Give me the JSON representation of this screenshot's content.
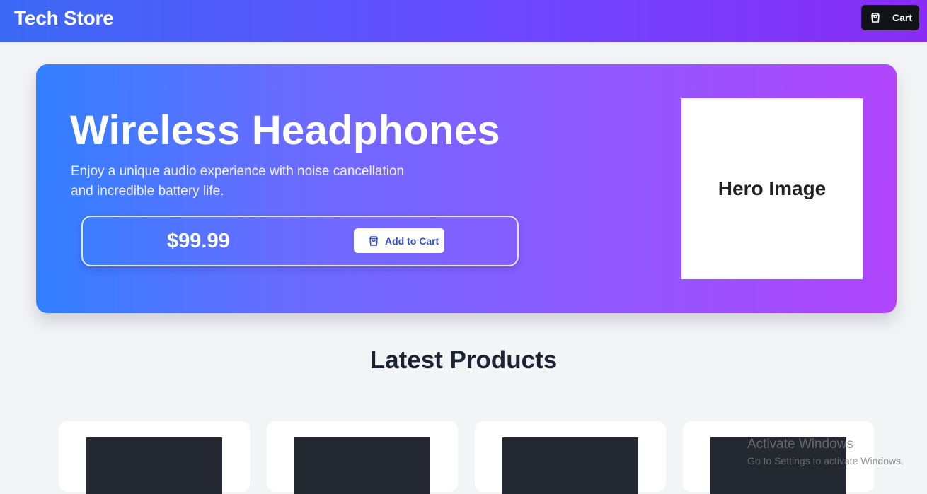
{
  "navbar": {
    "brand": "Tech Store",
    "cart_label": "Cart",
    "cart_icon": "shopping-bag-icon"
  },
  "hero": {
    "title": "Wireless Headphones",
    "description": "Enjoy a unique audio experience with noise cancellation and incredible battery life.",
    "price": "$99.99",
    "add_to_cart_label": "Add to Cart",
    "add_to_cart_icon": "shopping-bag-icon",
    "image_placeholder": "Hero Image"
  },
  "products": {
    "section_title": "Latest Products",
    "items": [
      {
        "thumb": "product-image-placeholder"
      },
      {
        "thumb": "product-image-placeholder"
      },
      {
        "thumb": "product-image-placeholder"
      },
      {
        "thumb": "product-image-placeholder"
      }
    ]
  },
  "watermark": {
    "line1": "Activate Windows",
    "line2": "Go to Settings to activate Windows."
  },
  "colors": {
    "nav_gradient_start": "#3b6af5",
    "nav_gradient_end": "#8a2cf5",
    "hero_gradient_start": "#3180ff",
    "hero_gradient_end": "#b045fb",
    "cart_button_bg": "#111318",
    "add_button_text": "#2f4fd6",
    "page_bg": "#f3f4f6",
    "thumb_bg": "#242831"
  }
}
